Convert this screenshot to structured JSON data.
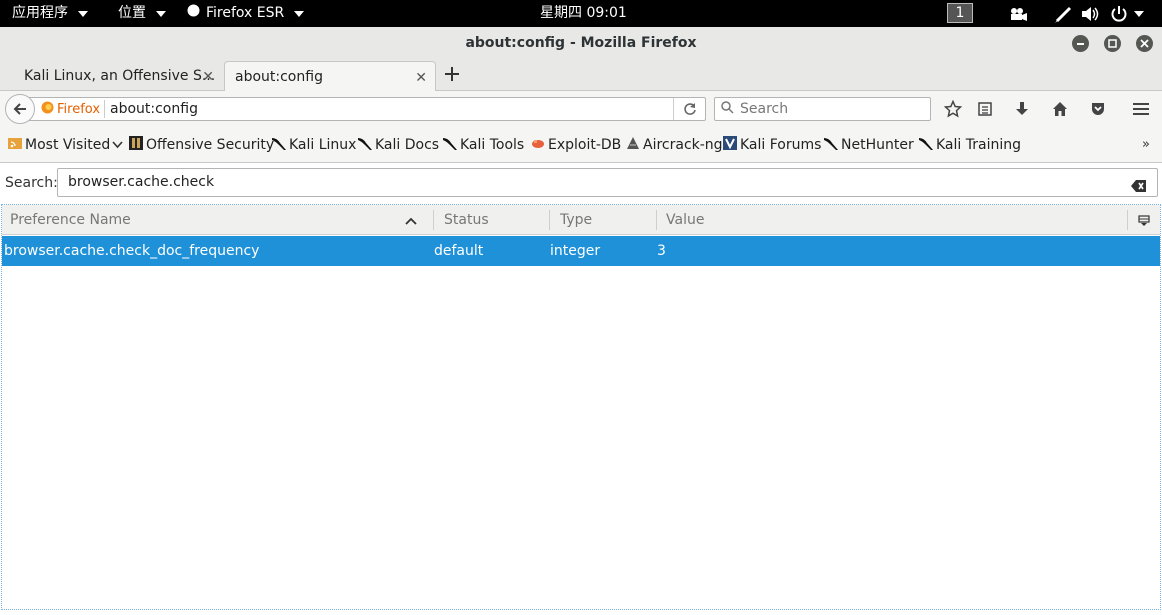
{
  "topbar": {
    "apps_label": "应用程序",
    "places_label": "位置",
    "app_label": "Firefox ESR",
    "clock": "星期四 09:01",
    "workspace": "1"
  },
  "window": {
    "title": "about:config - Mozilla Firefox"
  },
  "tabs": [
    {
      "label": "Kali Linux, an Offensive S..."
    },
    {
      "label": "about:config"
    }
  ],
  "navbar": {
    "identity_label": "Firefox",
    "url": "about:config",
    "search_placeholder": "Search"
  },
  "bookmarks": [
    {
      "label": "Most Visited"
    },
    {
      "label": "Offensive Security"
    },
    {
      "label": "Kali Linux"
    },
    {
      "label": "Kali Docs"
    },
    {
      "label": "Kali Tools"
    },
    {
      "label": "Exploit-DB"
    },
    {
      "label": "Aircrack-ng"
    },
    {
      "label": "Kali Forums"
    },
    {
      "label": "NetHunter"
    },
    {
      "label": "Kali Training"
    }
  ],
  "config": {
    "search_label": "Search:",
    "filter_value": "browser.cache.check",
    "columns": [
      "Preference Name",
      "Status",
      "Type",
      "Value"
    ],
    "rows": [
      {
        "name": "browser.cache.check_doc_frequency",
        "status": "default",
        "type": "integer",
        "value": "3"
      }
    ]
  },
  "colors": {
    "selection": "#1e91d8",
    "firefox_orange": "#e66000"
  }
}
